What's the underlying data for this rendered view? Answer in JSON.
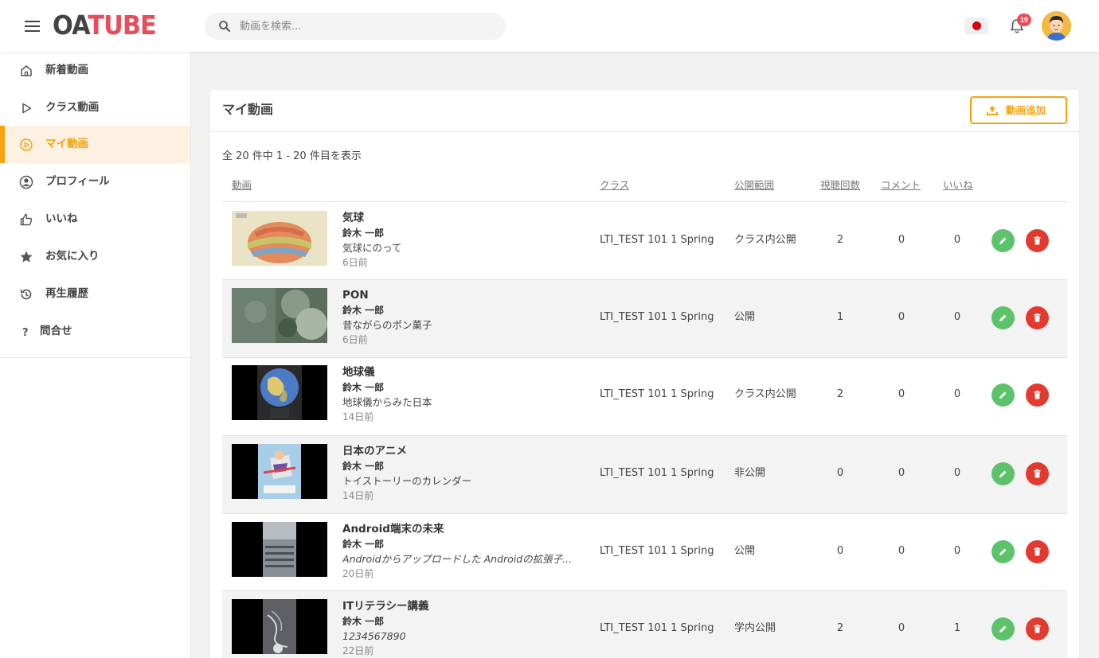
{
  "app": {
    "logo_a": "OA",
    "logo_b": "TUBE"
  },
  "header": {
    "search_placeholder": "動画を検索...",
    "notification_count": "19",
    "flag": "japan-flag"
  },
  "sidebar": {
    "items": [
      {
        "label": "新着動画",
        "icon": "home-icon"
      },
      {
        "label": "クラス動画",
        "icon": "play-icon"
      },
      {
        "label": "マイ動画",
        "icon": "play-circle-icon",
        "active": true
      },
      {
        "label": "プロフィール",
        "icon": "user-circle-icon"
      },
      {
        "label": "いいね",
        "icon": "thumbs-up-icon"
      },
      {
        "label": "お気に入り",
        "icon": "star-icon"
      },
      {
        "label": "再生履歴",
        "icon": "history-icon"
      },
      {
        "label": "問合せ",
        "icon": "question-icon"
      }
    ]
  },
  "main": {
    "title": "マイ動画",
    "add_button": "動画追加",
    "count_text": "全 20 件中 1 - 20 件目を表示",
    "columns": {
      "video": "動画",
      "class": "クラス",
      "visibility": "公開範囲",
      "views": "視聴回数",
      "comments": "コメント",
      "likes": "いいね"
    },
    "rows": [
      {
        "title": "気球",
        "author": "鈴木 一郎",
        "desc": "気球にのって",
        "desc_italic": false,
        "date": "6日前",
        "class": "LTI_TEST 101 1 Spring",
        "visibility": "クラス内公開",
        "views": "2",
        "comments": "0",
        "likes": "0",
        "thumb": "balloon"
      },
      {
        "title": "PON",
        "author": "鈴木 一郎",
        "desc": "昔ながらのポン菓子",
        "desc_italic": false,
        "date": "6日前",
        "class": "LTI_TEST 101 1 Spring",
        "visibility": "公開",
        "views": "1",
        "comments": "0",
        "likes": "0",
        "thumb": "pon"
      },
      {
        "title": "地球儀",
        "author": "鈴木 一郎",
        "desc": "地球儀からみた日本",
        "desc_italic": false,
        "date": "14日前",
        "class": "LTI_TEST 101 1 Spring",
        "visibility": "クラス内公開",
        "views": "2",
        "comments": "0",
        "likes": "0",
        "thumb": "globe"
      },
      {
        "title": "日本のアニメ",
        "author": "鈴木 一郎",
        "desc": "トイストーリーのカレンダー",
        "desc_italic": false,
        "date": "14日前",
        "class": "LTI_TEST 101 1 Spring",
        "visibility": "非公開",
        "views": "0",
        "comments": "0",
        "likes": "0",
        "thumb": "anime"
      },
      {
        "title": "Android端末の未来",
        "author": "鈴木 一郎",
        "desc": "Androidからアップロードした Androidの拡張子...",
        "desc_italic": true,
        "date": "20日前",
        "class": "LTI_TEST 101 1 Spring",
        "visibility": "公開",
        "views": "0",
        "comments": "0",
        "likes": "0",
        "thumb": "keyboard"
      },
      {
        "title": "ITリテラシー講義",
        "author": "鈴木 一郎",
        "desc": "1234567890",
        "desc_italic": true,
        "date": "22日前",
        "class": "LTI_TEST 101 1 Spring",
        "visibility": "学内公開",
        "views": "2",
        "comments": "0",
        "likes": "1",
        "thumb": "cable"
      }
    ]
  },
  "colors": {
    "accent": "#f5a20c",
    "brand_red": "#e84d5b",
    "edit": "#5cc36a",
    "delete": "#e33a30"
  }
}
